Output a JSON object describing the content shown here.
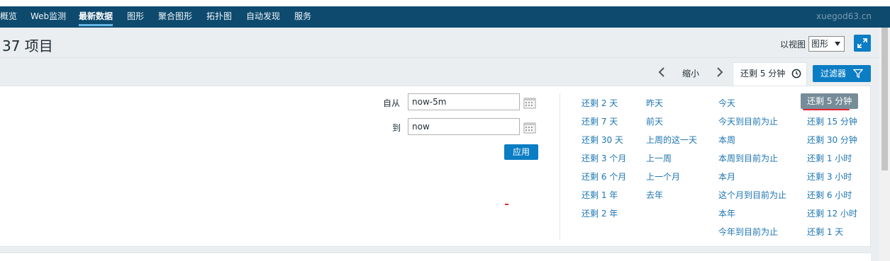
{
  "nav": {
    "items": [
      {
        "label": "概览"
      },
      {
        "label": "Web监测"
      },
      {
        "label": "最新数据"
      },
      {
        "label": "图形"
      },
      {
        "label": "聚合图形"
      },
      {
        "label": "拓扑图"
      },
      {
        "label": "自动发现"
      },
      {
        "label": "服务"
      }
    ],
    "active_index": 2,
    "server_name": "xuegod63.cn"
  },
  "header": {
    "title": "37 项目",
    "view_label": "以视图",
    "view_select_value": "图形"
  },
  "filter_bar": {
    "zoom_out_label": "缩小",
    "time_tab_label": "还剩 5 分钟",
    "filter_button_label": "过滤器"
  },
  "time_form": {
    "from_label": "自从",
    "from_value": "now-5m",
    "to_label": "到",
    "to_value": "now",
    "apply_label": "应用"
  },
  "quick_ranges": {
    "col1": [
      "还剩 2 天",
      "还剩 7 天",
      "还剩 30 天",
      "还剩 3 个月",
      "还剩 6 个月",
      "还剩 1 年",
      "还剩 2 年"
    ],
    "col2": [
      "昨天",
      "前天",
      "上周的这一天",
      "上一周",
      "上一个月",
      "去年"
    ],
    "col3": [
      "今天",
      "今天到目前为止",
      "本周",
      "本周到目前为止",
      "本月",
      "这个月到目前为止",
      "本年",
      "今年到目前为止"
    ],
    "col4": [
      "还剩 5 分钟",
      "还剩 15 分钟",
      "还剩 30 分钟",
      "还剩 1 小时",
      "还剩 3 小时",
      "还剩 6 小时",
      "还剩 12 小时",
      "还剩 1 天"
    ],
    "selected": "还剩 5 分钟"
  },
  "colors": {
    "nav_bg": "#0d4a6e",
    "accent": "#0b7dc4",
    "link": "#1d76b2",
    "selected_bg": "#768d99"
  }
}
